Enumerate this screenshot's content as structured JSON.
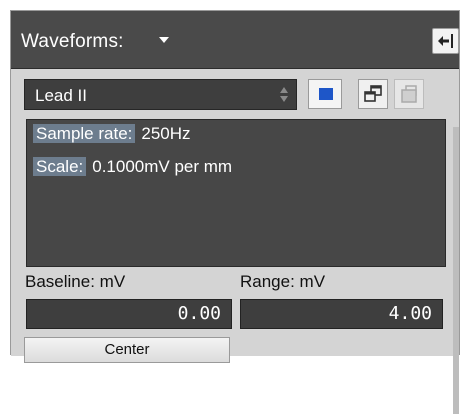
{
  "header": {
    "title": "Waveforms:"
  },
  "lead": {
    "selected": "Lead II"
  },
  "info": {
    "sample_rate_label": "Sample rate:",
    "sample_rate_value": "250Hz",
    "scale_label": "Scale:",
    "scale_value": "0.1000mV per mm"
  },
  "baseline": {
    "label": "Baseline: mV",
    "value": "0.00"
  },
  "range": {
    "label": "Range: mV",
    "value": "4.00"
  },
  "center_button": {
    "label": "Center"
  },
  "icons": {
    "back": "back-arrow-icon",
    "square": "stop-square-icon",
    "copy": "copy-windows-icon",
    "disabled": "disabled-window-icon"
  },
  "colors": {
    "accent_square": "#1e56c8",
    "titlebar": "#4a4a4a",
    "label_highlight": "#6d7d8e"
  }
}
